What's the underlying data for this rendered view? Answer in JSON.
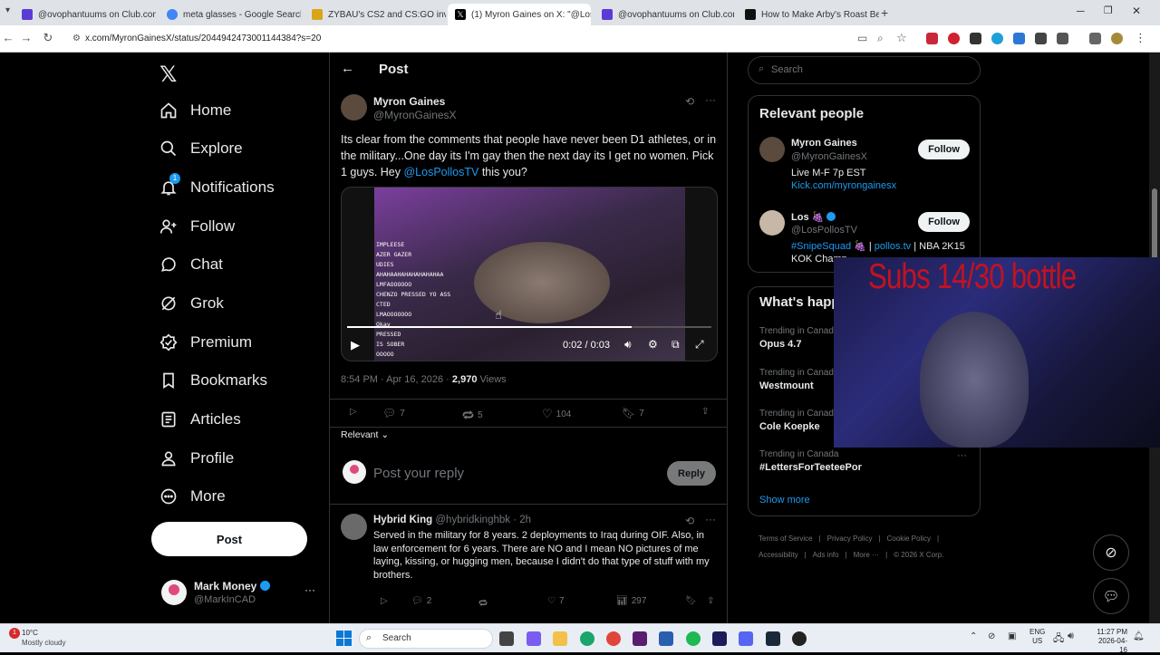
{
  "browser": {
    "tabs": [
      {
        "title": "@ovophantuums on Club.com",
        "color": "#5b3bd6"
      },
      {
        "title": "meta glasses - Google Search",
        "color": "#4285f4"
      },
      {
        "title": "ZYBAU's CS2 and CS:GO invent",
        "color": "#d8a516"
      },
      {
        "title": "(1) Myron Gaines on X: \"@LosP",
        "color": "#000000"
      },
      {
        "title": "@ovophantuums on Club.com",
        "color": "#5b3bd6"
      },
      {
        "title": "How to Make Arby's Roast Bee",
        "color": "#111111"
      }
    ],
    "url": "x.com/MyronGainesX/status/2044942473001144384?s=20"
  },
  "sidebar": {
    "items": [
      {
        "label": "Home",
        "icon": "home-icon"
      },
      {
        "label": "Explore",
        "icon": "search-icon"
      },
      {
        "label": "Notifications",
        "icon": "bell-icon",
        "badge": "1"
      },
      {
        "label": "Follow",
        "icon": "person-add-icon"
      },
      {
        "label": "Chat",
        "icon": "chat-bubble-icon"
      },
      {
        "label": "Grok",
        "icon": "grok-icon"
      },
      {
        "label": "Premium",
        "icon": "verified-badge-icon"
      },
      {
        "label": "Bookmarks",
        "icon": "bookmark-icon"
      },
      {
        "label": "Articles",
        "icon": "article-icon"
      },
      {
        "label": "Profile",
        "icon": "person-icon"
      },
      {
        "label": "More",
        "icon": "more-circle-icon"
      }
    ],
    "post_label": "Post",
    "account": {
      "name": "Mark Money",
      "handle": "@MarkInCAD"
    }
  },
  "main": {
    "header_title": "Post",
    "post": {
      "author_name": "Myron Gaines",
      "author_handle": "@MyronGainesX",
      "text_1": "Its clear from the comments that people have never been D1 athletes, or in the military...One day its I'm gay then the next day its I get no women. Pick 1 guys. Hey ",
      "mention": "@LosPollosTV",
      "text_2": " this you?",
      "video": {
        "time": "0:02 / 0:03",
        "progress": 0.78,
        "overlay_lines": [
          "IMPLEESE",
          "AZER GAZER",
          "UDIES",
          "AHAHAAHAHAHAHAHAHAA",
          "LMFAOOOOOO",
          "CHENZO PRESSED YO ASS",
          "CTED",
          "LMAOOOOOOO",
          "Okay",
          "PRESSED",
          "IS SOBER",
          "OOOOO"
        ]
      },
      "timestamp": "8:54 PM · Apr 16, 2026 · ",
      "views_count": "2,970",
      "views_label": " Views",
      "stats": {
        "replies": "7",
        "reposts": "5",
        "likes": "104",
        "bookmarks": "7"
      }
    },
    "sort_label": "Relevant",
    "reply_placeholder": "Post your reply",
    "reply_button": "Reply",
    "reply": {
      "author_name": "Hybrid King",
      "author_handle": "@hybridkinghbk",
      "time": "· 2h",
      "text": "Served in the military for 8 years. 2 deployments to Iraq during OIF. Also, in law enforcement for 6 years. There are NO and I mean NO pictures of me laying, kissing, or hugging men, because I didn't do that type of stuff with my brothers.",
      "stats": {
        "replies": "2",
        "likes": "7",
        "views": "297"
      }
    }
  },
  "right": {
    "search_placeholder": "Search",
    "relevant_title": "Relevant people",
    "people": [
      {
        "name": "Myron Gaines",
        "handle": "@MyronGainesX",
        "bio": "Live M-F 7p EST",
        "bio_link": "Kick.com/myrongainesx",
        "follow": "Follow"
      },
      {
        "name": "Los 🍇",
        "handle": "@LosPollosTV",
        "bio_link": "#SnipeSquad 🍇",
        "bio_sep": " | ",
        "bio_link2": "pollos.tv",
        "bio_rest": " | NBA 2K15 KOK Champ",
        "follow": "Follow"
      }
    ],
    "happening_title": "What's happening",
    "trends": [
      {
        "context": "Trending in Canada",
        "name": "Opus 4.7"
      },
      {
        "context": "Trending in Canada",
        "name": "Westmount"
      },
      {
        "context": "Trending in Canada",
        "name": "Cole Koepke"
      },
      {
        "context": "Trending in Canada",
        "name": "#LettersForTeeteePor"
      }
    ],
    "show_more": "Show more",
    "footer": [
      "Terms of Service",
      "Privacy Policy",
      "Cookie Policy",
      "Accessibility",
      "Ads info",
      "More ···",
      "© 2026 X Corp."
    ]
  },
  "overlay": {
    "subs_text": "Subs 14/30 bottle"
  },
  "taskbar": {
    "weather_temp": "10°C",
    "weather_desc": "Mostly cloudy",
    "weather_badge": "1",
    "search_label": "Search",
    "lang_1": "ENG",
    "lang_2": "US",
    "time": "11:27 PM",
    "date": "2026-04-16"
  }
}
